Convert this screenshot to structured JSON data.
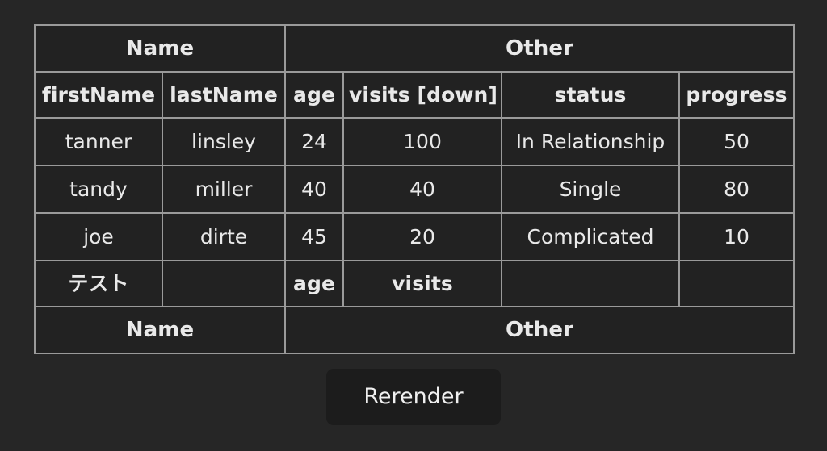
{
  "table": {
    "group_headers": [
      {
        "label": "Name",
        "colspan": 2
      },
      {
        "label": "Other",
        "colspan": 4
      }
    ],
    "column_headers": [
      "firstName",
      "lastName",
      "age",
      "visits [down]",
      "status",
      "progress"
    ],
    "sort": {
      "column": "visits",
      "direction": "down",
      "indicator": "[down]"
    },
    "rows": [
      {
        "firstName": "tanner",
        "lastName": "linsley",
        "age": "24",
        "visits": "100",
        "status": "In Relationship",
        "progress": "50"
      },
      {
        "firstName": "tandy",
        "lastName": "miller",
        "age": "40",
        "visits": "40",
        "status": "Single",
        "progress": "80"
      },
      {
        "firstName": "joe",
        "lastName": "dirte",
        "age": "45",
        "visits": "20",
        "status": "Complicated",
        "progress": "10"
      }
    ],
    "footer_columns": [
      "テスト",
      "",
      "age",
      "visits",
      "",
      ""
    ],
    "footer_groups": [
      {
        "label": "Name",
        "colspan": 2
      },
      {
        "label": "Other",
        "colspan": 4
      }
    ]
  },
  "controls": {
    "rerender_label": "Rerender"
  },
  "theme": {
    "page_background": "#262626",
    "cell_background": "#222222",
    "border_color": "#9a9a9a",
    "text_color": "#e9e9e9",
    "button_background": "#1c1c1c"
  }
}
